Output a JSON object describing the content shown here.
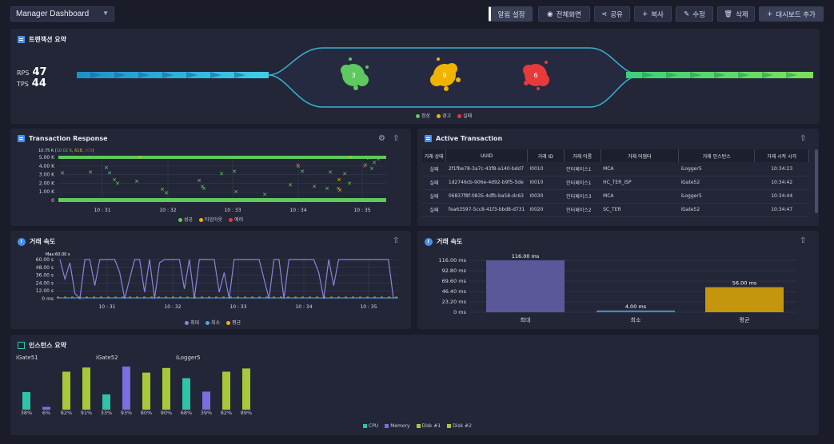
{
  "topbar": {
    "dashboard_select": "Manager Dashboard",
    "buttons": [
      "알림 설정",
      "전체화면",
      "공유",
      "복사",
      "수정",
      "삭제",
      "대시보드 추가"
    ]
  },
  "tx_summary": {
    "title": "트랜잭션 요약",
    "rps_label": "RPS",
    "rps_value": "47",
    "tps_label": "TPS",
    "tps_value": "44",
    "bubbles": [
      {
        "label": "정상",
        "count": "3",
        "color": "#5ec95e"
      },
      {
        "label": "경고",
        "count": "9",
        "color": "#f0b400"
      },
      {
        "label": "실패",
        "count": "6",
        "color": "#e83a3a"
      }
    ]
  },
  "tx_response": {
    "title": "Transaction Response",
    "peak_label": "10.75 K",
    "peak_counts": [
      "10.02 K",
      "618",
      "103"
    ],
    "legend": [
      "성공",
      "타임아웃",
      "에러"
    ]
  },
  "active_tx": {
    "title": "Active Transaction",
    "columns": [
      "거래 상태",
      "UUID",
      "거래 ID",
      "거래 이름",
      "거래 어댑터",
      "거래 인스턴스",
      "거래 시작 시각"
    ],
    "rows": [
      [
        "실패",
        "2f1fbe78-3a7c-43f8-a140-bdd7",
        "I0010",
        "인터페이스1",
        "MCA",
        "iLogger5",
        "10:34:23"
      ],
      [
        "실패",
        "1d2746cb-906e-4d92-b9f5-5de",
        "I0010",
        "인터페이스1",
        "HC_TER_ISP",
        "iGate52",
        "10:34:42"
      ],
      [
        "실패",
        "06837f8f-0835-4dfb-ba58-dc63",
        "I0030",
        "인터페이스3",
        "MCA",
        "iLogger5",
        "10:34:44"
      ],
      [
        "실패",
        "fea63597-5cc8-41f3-bbd8-d731",
        "I0020",
        "인터페이스2",
        "SC_TER",
        "iGate52",
        "10:34:47"
      ]
    ]
  },
  "speed_line": {
    "title": "거래 속도",
    "max_label": "Max:60.00 s",
    "legend": [
      "최대",
      "최소",
      "평균"
    ]
  },
  "speed_bar": {
    "title": "거래 속도"
  },
  "instance_summary": {
    "title": "인스턴스 요약",
    "legend": [
      "CPU",
      "Memory",
      "Disk #1",
      "Disk #2"
    ]
  },
  "chart_data": [
    {
      "type": "scatter",
      "title": "Transaction Response",
      "y_ticks": [
        "5.00 K",
        "4.00 K",
        "3.00 K",
        "2.00 K",
        "1.00 K",
        "0"
      ],
      "x_ticks": [
        "10 : 31",
        "10 : 32",
        "10 : 33",
        "10 : 34",
        "10 : 35"
      ],
      "ylim": [
        0,
        5000
      ],
      "series": [
        {
          "name": "성공",
          "color": "#5ec95e"
        },
        {
          "name": "타임아웃",
          "color": "#f0b400"
        },
        {
          "name": "에러",
          "color": "#e83a3a"
        }
      ]
    },
    {
      "type": "line",
      "title": "거래 속도",
      "y_ticks": [
        "60.00 s",
        "48.00 s",
        "36.00 s",
        "24.00 s",
        "12.00 s",
        "0 ms"
      ],
      "x_ticks": [
        "10 : 31",
        "10 : 32",
        "10 : 33",
        "10 : 34",
        "10 : 35"
      ],
      "ylim": [
        0,
        60
      ],
      "series": [
        {
          "name": "최대",
          "color": "#8a84d8"
        },
        {
          "name": "최소",
          "color": "#4aa8e0"
        },
        {
          "name": "평균",
          "color": "#f0b400"
        }
      ]
    },
    {
      "type": "bar",
      "title": "거래 속도",
      "y_ticks": [
        "116.00 ms",
        "92.80 ms",
        "69.60 ms",
        "46.40 ms",
        "23.20 ms",
        "0 ms"
      ],
      "ylim": [
        0,
        116
      ],
      "categories": [
        "최대",
        "최소",
        "평균"
      ],
      "values": [
        116,
        4,
        56
      ],
      "value_labels": [
        "116.00 ms",
        "4.00 ms",
        "56.00 ms"
      ],
      "colors": [
        "#5b589a",
        "#4a86b8",
        "#c4960e"
      ]
    },
    {
      "type": "bar",
      "title": "인스턴스 요약",
      "ylim": [
        0,
        100
      ],
      "groups": [
        {
          "name": "iGate51",
          "values": [
            38,
            6,
            82,
            91
          ],
          "labels": [
            "38%",
            "6%",
            "82%",
            "91%"
          ]
        },
        {
          "name": "iGate52",
          "values": [
            33,
            93,
            80,
            90
          ],
          "labels": [
            "33%",
            "93%",
            "80%",
            "90%"
          ]
        },
        {
          "name": "iLogger5",
          "values": [
            68,
            39,
            82,
            89
          ],
          "labels": [
            "68%",
            "39%",
            "82%",
            "89%"
          ]
        }
      ],
      "series": [
        {
          "name": "CPU",
          "color": "#2ec4a8"
        },
        {
          "name": "Memory",
          "color": "#7a6ee0"
        },
        {
          "name": "Disk #1",
          "color": "#a8c83a"
        },
        {
          "name": "Disk #2",
          "color": "#a8c83a"
        }
      ]
    }
  ]
}
